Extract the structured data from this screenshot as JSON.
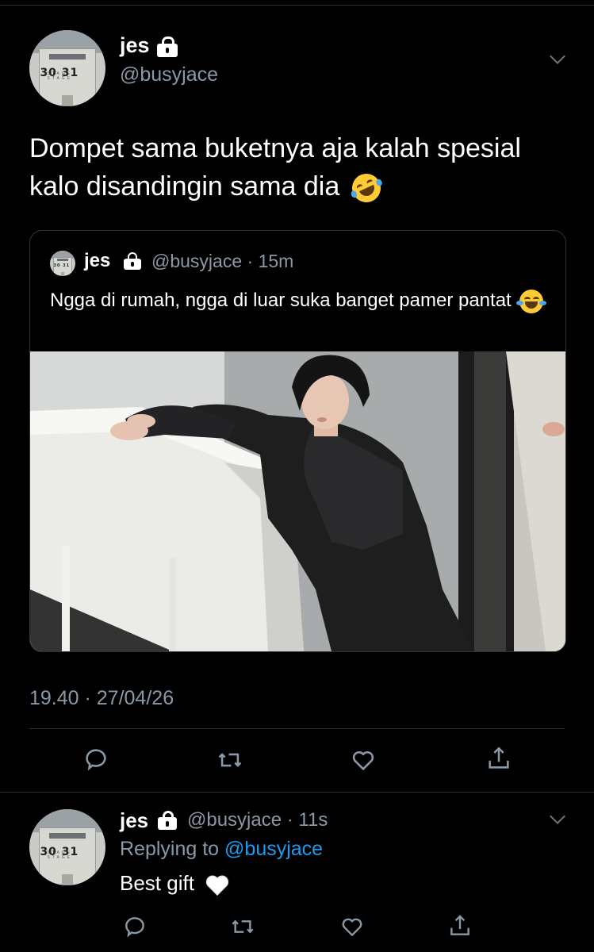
{
  "main_tweet": {
    "display_name": "jes",
    "handle": "@busyjace",
    "text": "Dompet sama buketnya aja kalah spesial kalo disandingin sama dia",
    "emoji": "rolling-on-floor-laughing",
    "timestamp": "19.40 · 27/04/26",
    "avatar_numbers": "30 31"
  },
  "quote": {
    "display_name": "jes",
    "handle_time": "@busyjace · 15m",
    "text": "Ngga di rumah, ngga di luar suka banget pamer pantat",
    "emoji": "face-with-tears-of-joy"
  },
  "actions": {
    "icons": [
      "reply-icon",
      "retweet-icon",
      "like-icon",
      "share-icon"
    ]
  },
  "reply": {
    "display_name": "jes",
    "handle_time": "@busyjace · 11s",
    "replying_prefix": "Replying to",
    "replying_handle": "@busyjace",
    "text": "Best gift",
    "emoji": "white-heart"
  },
  "colors": {
    "background": "#000000",
    "secondary_text": "#8b98a5",
    "link": "#1d9bf0",
    "divider": "#2f3336"
  }
}
